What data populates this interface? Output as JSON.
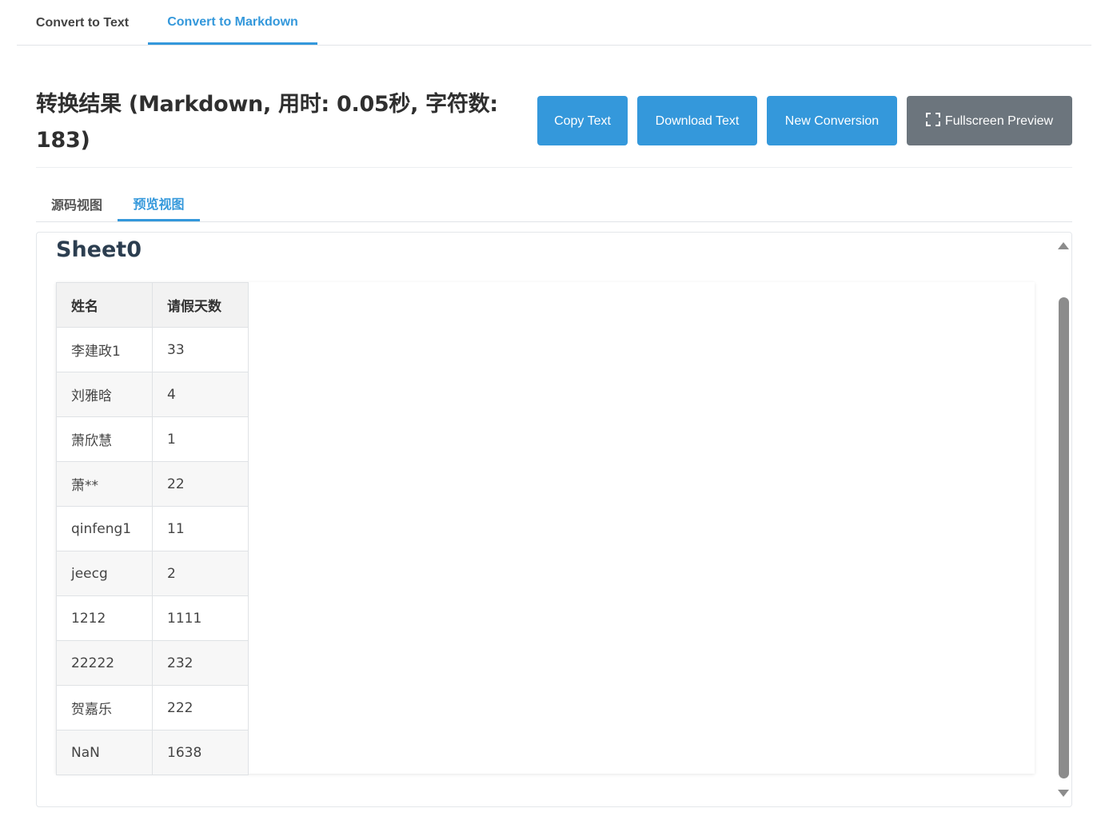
{
  "top_tabs": [
    {
      "label": "Convert to Text",
      "active": false
    },
    {
      "label": "Convert to Markdown",
      "active": true
    }
  ],
  "result": {
    "title": "转换结果 (Markdown, 用时: 0.05秒, 字符数: 183)"
  },
  "actions": {
    "copy_label": "Copy Text",
    "download_label": "Download Text",
    "new_label": "New Conversion",
    "fullscreen_label": "Fullscreen Preview"
  },
  "view_tabs": [
    {
      "label": "源码视图",
      "active": false
    },
    {
      "label": "预览视图",
      "active": true
    }
  ],
  "preview": {
    "sheet_title": "Sheet0",
    "table": {
      "headers": [
        "姓名",
        "请假天数"
      ],
      "rows": [
        [
          "李建政1",
          "33"
        ],
        [
          "刘雅晗",
          "4"
        ],
        [
          "萧欣慧",
          "1"
        ],
        [
          "萧**",
          "22"
        ],
        [
          "qinfeng1",
          "11"
        ],
        [
          "jeecg",
          "2"
        ],
        [
          "1212",
          "1111"
        ],
        [
          "22222",
          "232"
        ],
        [
          "贺嘉乐",
          "222"
        ],
        [
          "NaN",
          "1638"
        ]
      ]
    }
  },
  "colors": {
    "accent": "#3498db",
    "secondary_button": "#6c757d",
    "heading": "#2c3e50"
  }
}
